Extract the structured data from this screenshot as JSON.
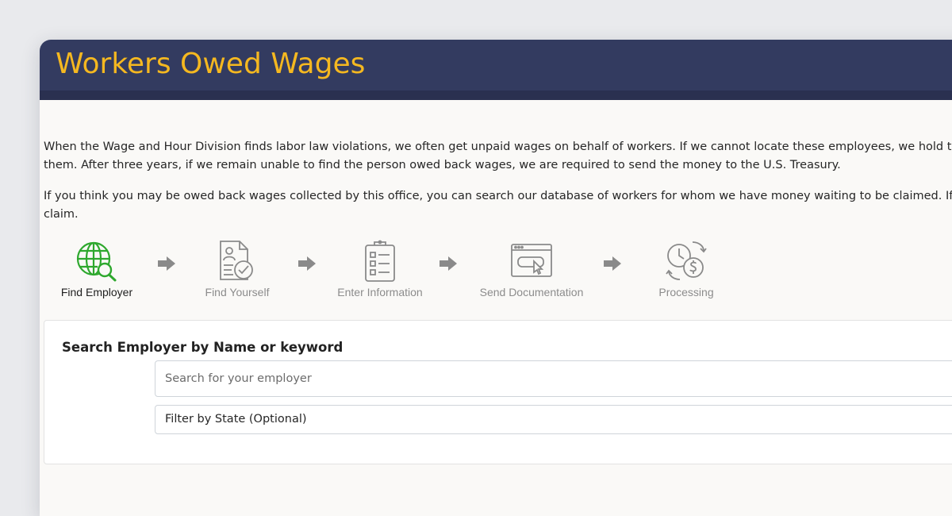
{
  "banner": {
    "title": "Workers Owed Wages",
    "title_color": "#f5b820",
    "background": "#333b60"
  },
  "intro": {
    "p1_line1": "When the Wage and Hour Division finds labor law violations, we often get unpaid wages on behalf of workers. If we cannot locate these employees, we hold their back",
    "p1_line2": "them. After three years, if we remain unable to find the person owed back wages, we are required to send the money to the U.S. Treasury.",
    "p2_line1": "If you think you may be owed back wages collected by this office, you can search our database of workers for whom we have money waiting to be claimed. If you find",
    "p2_line2": "claim."
  },
  "steps": [
    {
      "label": "Find Employer",
      "icon": "globe-search-icon",
      "active": true
    },
    {
      "label": "Find Yourself",
      "icon": "profile-document-check-icon",
      "active": false
    },
    {
      "label": "Enter Information",
      "icon": "clipboard-list-icon",
      "active": false
    },
    {
      "label": "Send Documentation",
      "icon": "browser-cursor-icon",
      "active": false
    },
    {
      "label": "Processing",
      "icon": "clock-dollar-exchange-icon",
      "active": false
    }
  ],
  "step_arrow_icon": "arrow-right-icon",
  "colors": {
    "active_icon": "#2ea82e",
    "inactive_icon": "#8a8a8a",
    "arrow": "#8a8a8a"
  },
  "search": {
    "heading": "Search Employer by Name or keyword",
    "employer_placeholder": "Search for your employer",
    "state_filter_label": "Filter by State (Optional)"
  }
}
